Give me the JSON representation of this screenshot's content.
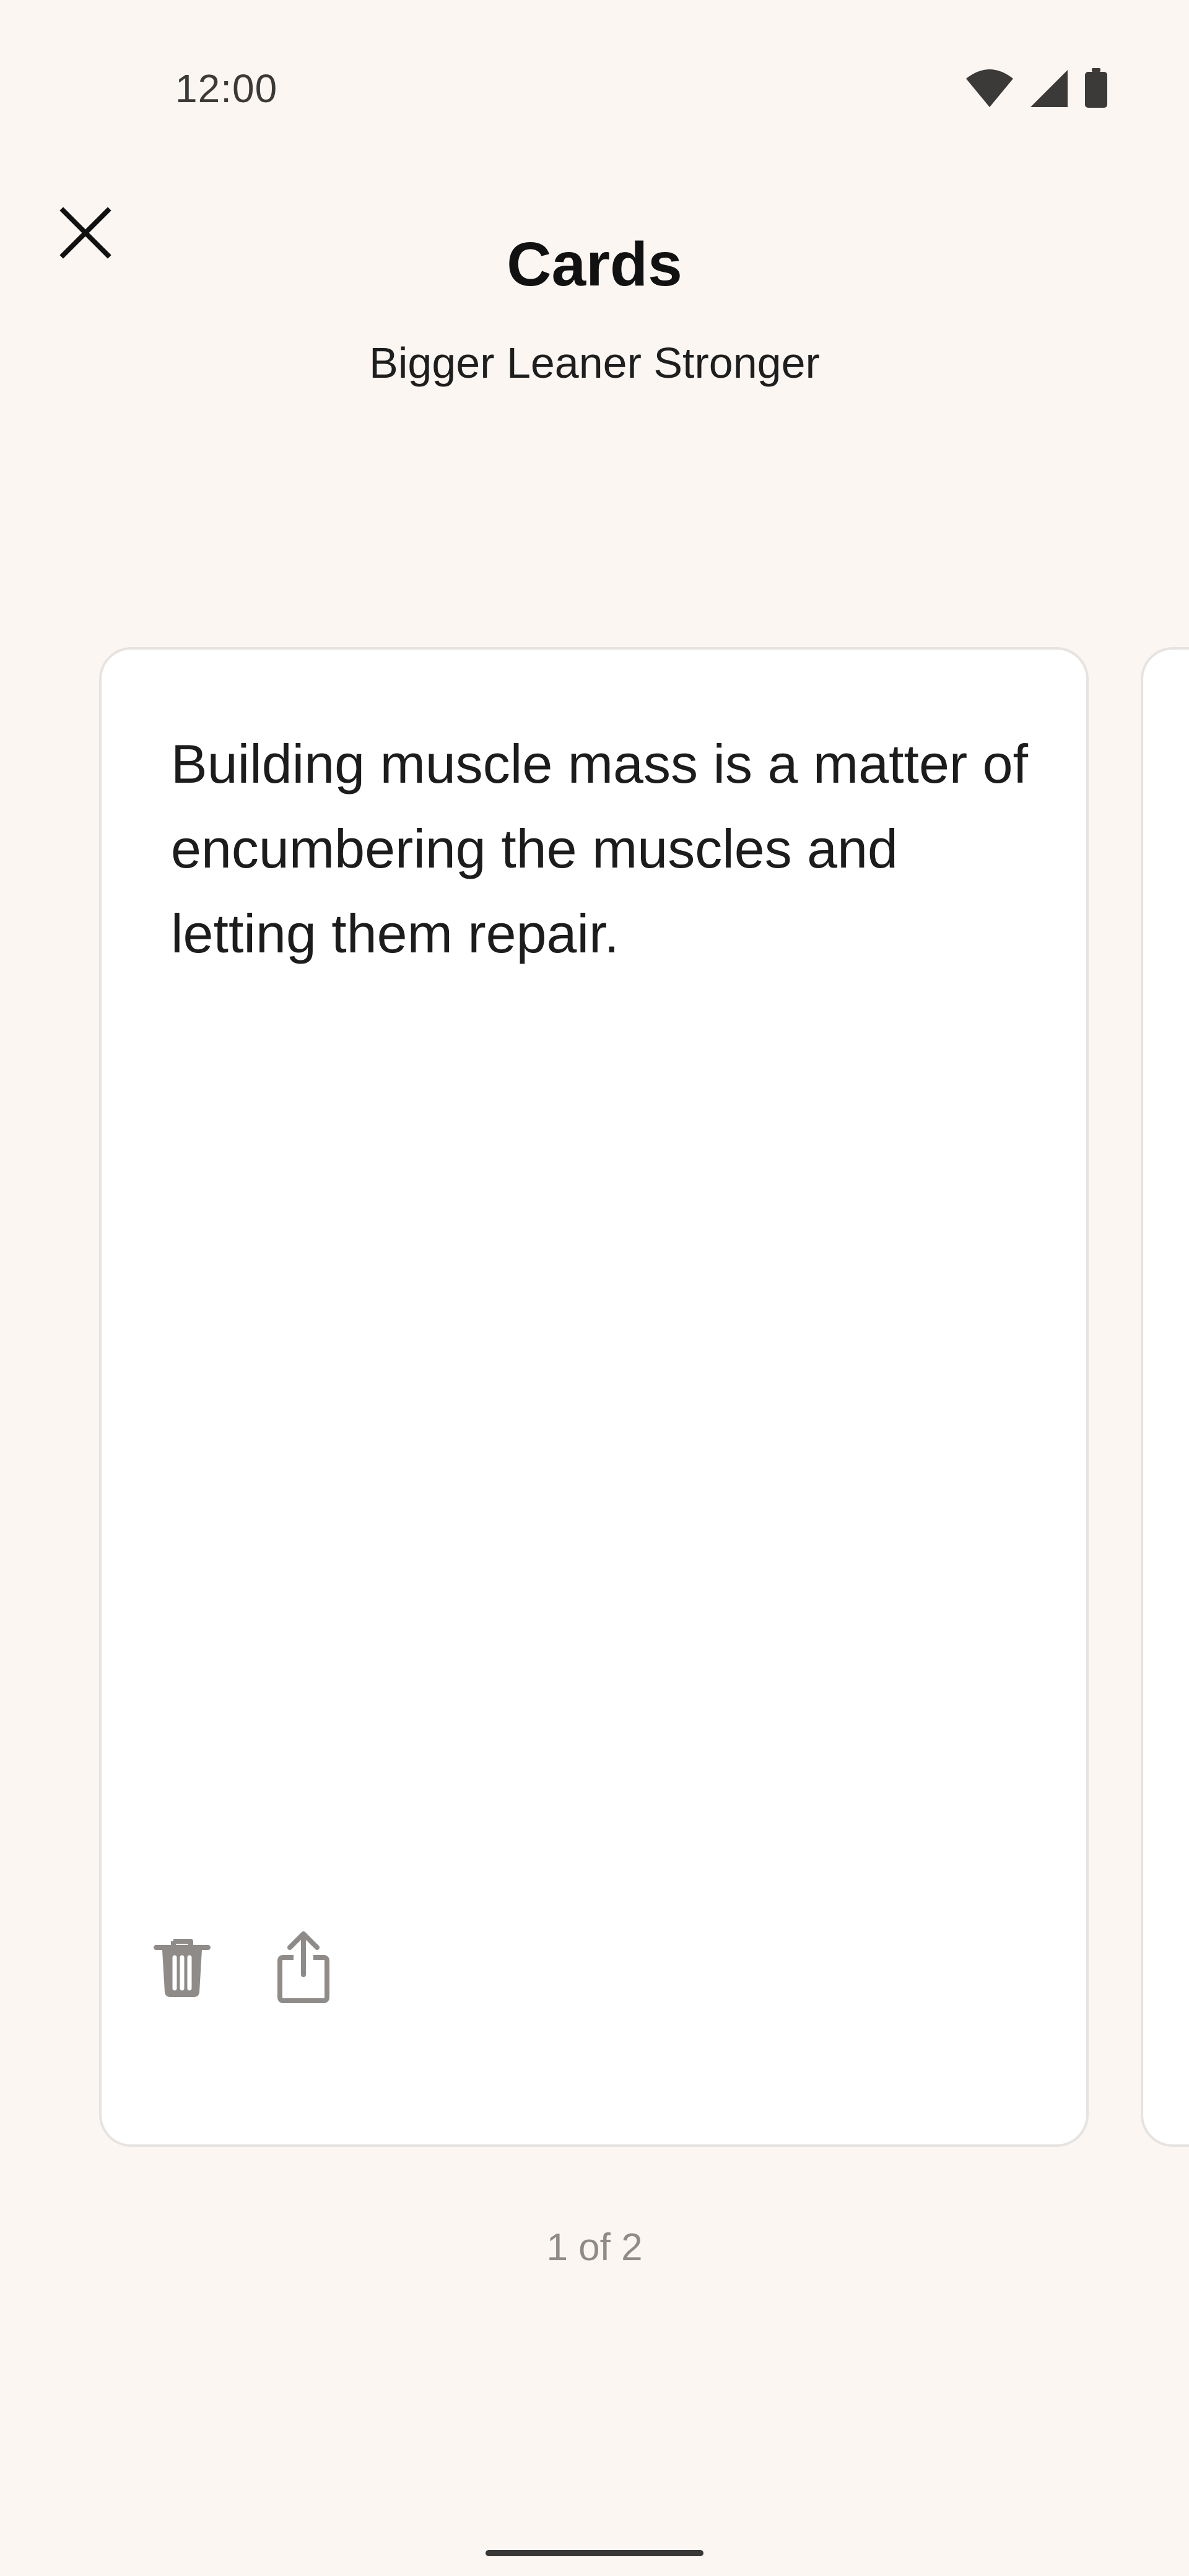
{
  "status_bar": {
    "time": "12:00",
    "icons": [
      "wifi-icon",
      "cellular-signal-icon",
      "battery-icon"
    ]
  },
  "header": {
    "close_icon": "close-icon",
    "title": "Cards",
    "subtitle": "Bigger Leaner Stronger"
  },
  "cards": [
    {
      "text": "Building muscle mass is a matter of encumbering the muscles and letting them repair.",
      "actions": [
        "trash-icon",
        "share-icon"
      ]
    }
  ],
  "pagination": {
    "label": "1 of 2",
    "current": 1,
    "total": 2
  },
  "colors": {
    "background": "#FBF6F2",
    "card": "#FFFFFF",
    "card_border": "#E6E3E0",
    "icon_muted": "#8E8B88"
  }
}
